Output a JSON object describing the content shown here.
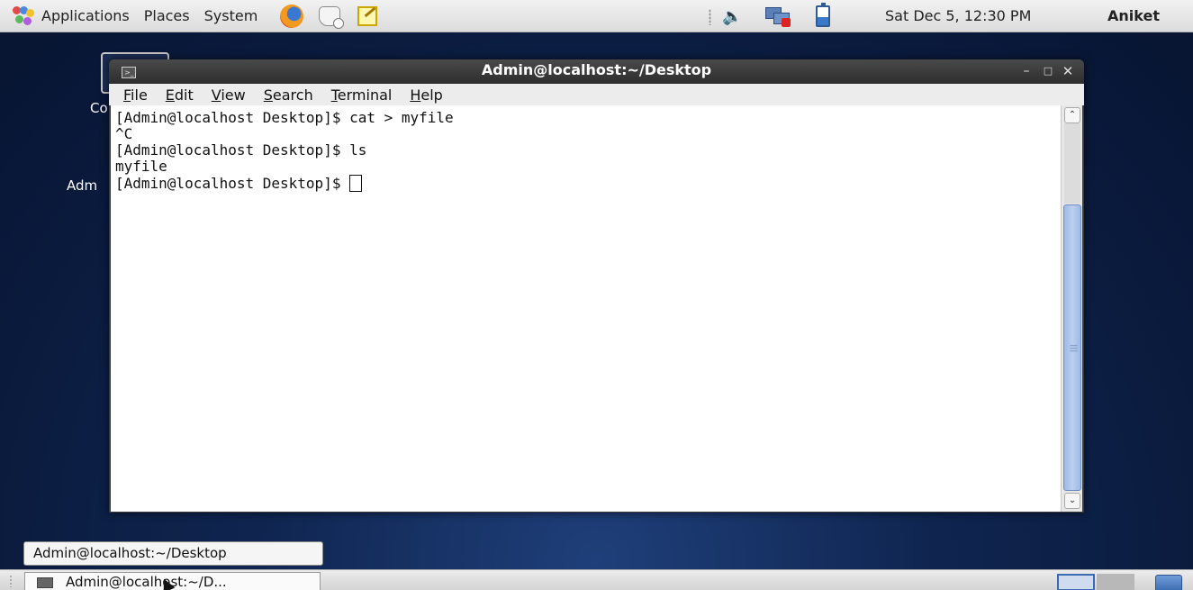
{
  "top_panel": {
    "menus": [
      "Applications",
      "Places",
      "System"
    ],
    "launchers": [
      "firefox-icon",
      "mail-icon",
      "notes-icon"
    ],
    "tray_icons": [
      "speaker-icon",
      "network-icon",
      "battery-icon"
    ],
    "clock": "Sat Dec  5, 12:30 PM",
    "user": "Aniket"
  },
  "desktop": {
    "icon_labels": [
      "Co",
      "Adm"
    ]
  },
  "window": {
    "title": "Admin@localhost:~/Desktop",
    "menu": [
      {
        "mnemonic": "F",
        "rest": "ile"
      },
      {
        "mnemonic": "E",
        "rest": "dit"
      },
      {
        "mnemonic": "V",
        "rest": "iew"
      },
      {
        "mnemonic": "S",
        "rest": "earch"
      },
      {
        "mnemonic": "T",
        "rest": "erminal"
      },
      {
        "mnemonic": "H",
        "rest": "elp"
      }
    ],
    "terminal_lines": [
      "[Admin@localhost Desktop]$ cat > myfile",
      "^C",
      "[Admin@localhost Desktop]$ ls",
      "myfile"
    ],
    "prompt": "[Admin@localhost Desktop]$ "
  },
  "tooltip": "Admin@localhost:~/Desktop",
  "taskbar": {
    "task_label": "Admin@localhost:~/D..."
  }
}
